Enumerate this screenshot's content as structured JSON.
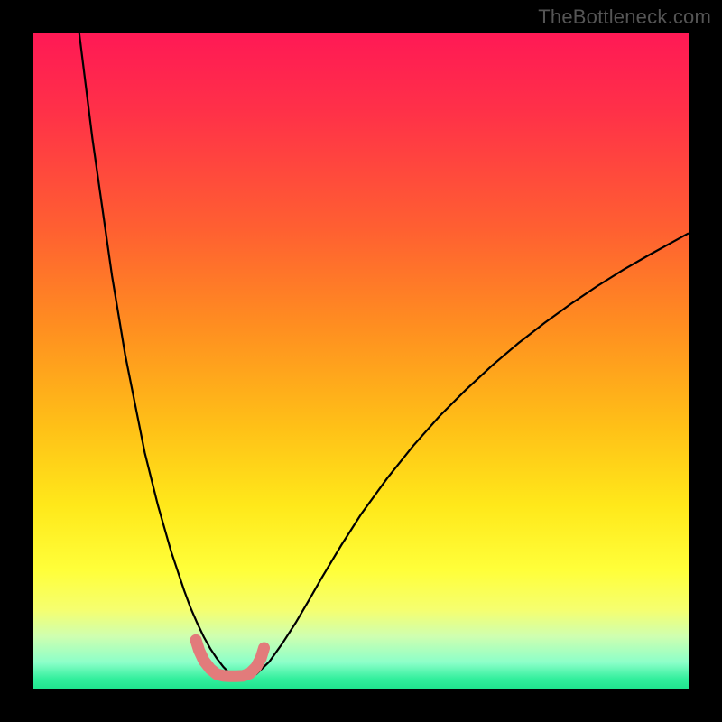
{
  "watermark": "TheBottleneck.com",
  "chart_data": {
    "type": "line",
    "title": "",
    "xlabel": "",
    "ylabel": "",
    "xlim": [
      0,
      100
    ],
    "ylim": [
      0,
      100
    ],
    "grid": false,
    "legend": false,
    "background_gradient": {
      "direction": "vertical",
      "stops": [
        {
          "pos": 0.0,
          "color": "#ff1955"
        },
        {
          "pos": 0.12,
          "color": "#ff3148"
        },
        {
          "pos": 0.3,
          "color": "#ff6031"
        },
        {
          "pos": 0.45,
          "color": "#ff8f20"
        },
        {
          "pos": 0.6,
          "color": "#ffc017"
        },
        {
          "pos": 0.72,
          "color": "#ffe81a"
        },
        {
          "pos": 0.82,
          "color": "#ffff3a"
        },
        {
          "pos": 0.88,
          "color": "#f5ff70"
        },
        {
          "pos": 0.92,
          "color": "#cfffb0"
        },
        {
          "pos": 0.96,
          "color": "#8cffc9"
        },
        {
          "pos": 0.985,
          "color": "#33ef9d"
        },
        {
          "pos": 1.0,
          "color": "#1fe58e"
        }
      ]
    },
    "series": [
      {
        "name": "bottleneck-curve",
        "color": "#000000",
        "stroke_width": 2.2,
        "x": [
          7,
          8,
          9,
          10,
          11,
          12,
          13,
          14,
          15,
          16,
          17,
          18,
          19,
          20,
          21,
          22,
          23,
          24,
          25,
          26,
          27,
          28,
          29,
          30,
          32,
          34,
          36,
          38,
          40,
          42,
          44,
          47,
          50,
          54,
          58,
          62,
          66,
          70,
          74,
          78,
          82,
          86,
          90,
          94,
          98,
          100
        ],
        "y": [
          100,
          92,
          84,
          77,
          70,
          63,
          57,
          51,
          46,
          41,
          36,
          32,
          28,
          24.5,
          21,
          18,
          15,
          12.3,
          10,
          7.9,
          6.1,
          4.6,
          3.3,
          2.3,
          2.1,
          2.2,
          4.1,
          6.9,
          10,
          13.4,
          16.9,
          21.9,
          26.6,
          32.1,
          37.1,
          41.6,
          45.6,
          49.3,
          52.7,
          55.8,
          58.7,
          61.4,
          63.9,
          66.2,
          68.4,
          69.5
        ]
      },
      {
        "name": "optimal-band-marker",
        "color": "#e27b7b",
        "stroke_width": 13,
        "linecap": "round",
        "x": [
          24.8,
          25.3,
          26,
          27,
          28,
          29,
          30,
          31,
          32,
          33,
          34,
          34.7,
          35.2
        ],
        "y": [
          7.4,
          5.8,
          4.3,
          3.0,
          2.2,
          1.95,
          1.9,
          1.9,
          1.95,
          2.3,
          3.3,
          4.6,
          6.2
        ]
      }
    ]
  }
}
